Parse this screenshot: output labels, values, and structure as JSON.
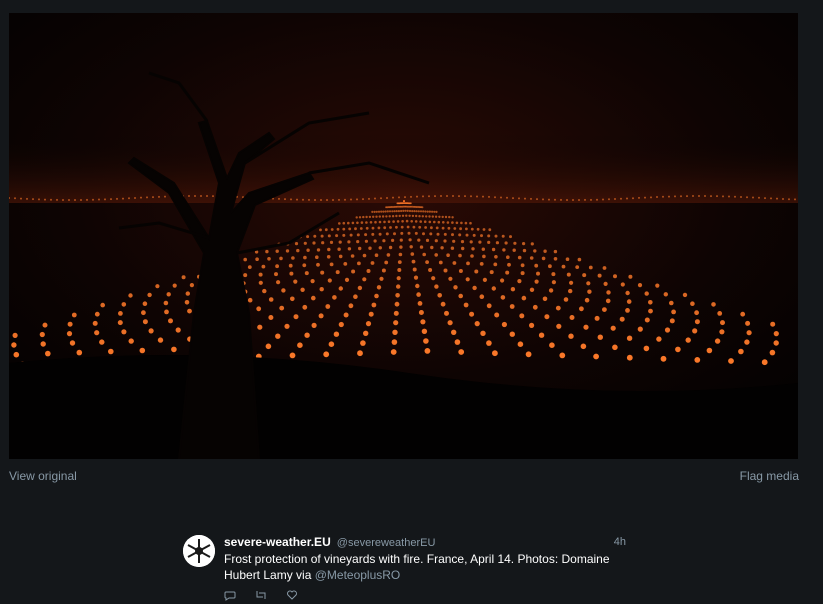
{
  "media": {
    "view_original_label": "View original",
    "flag_media_label": "Flag media",
    "image_subject": "photo"
  },
  "tweet": {
    "display_name": "severe-weather.EU",
    "handle": "@severeweatherEU",
    "timestamp": "4h",
    "text": "Frost protection of vineyards with fire. France, April 14. Photos: Domaine Hubert Lamy via",
    "mention": "@MeteoplusRO",
    "avatar_icon": "snowflake-logo-icon"
  },
  "actions": {
    "reply_icon": "reply-icon",
    "retweet_icon": "retweet-icon",
    "like_icon": "heart-icon"
  },
  "colors": {
    "background": "#14171a",
    "muted_text": "#8899a6",
    "fire_glow": "#ff7a2a"
  }
}
